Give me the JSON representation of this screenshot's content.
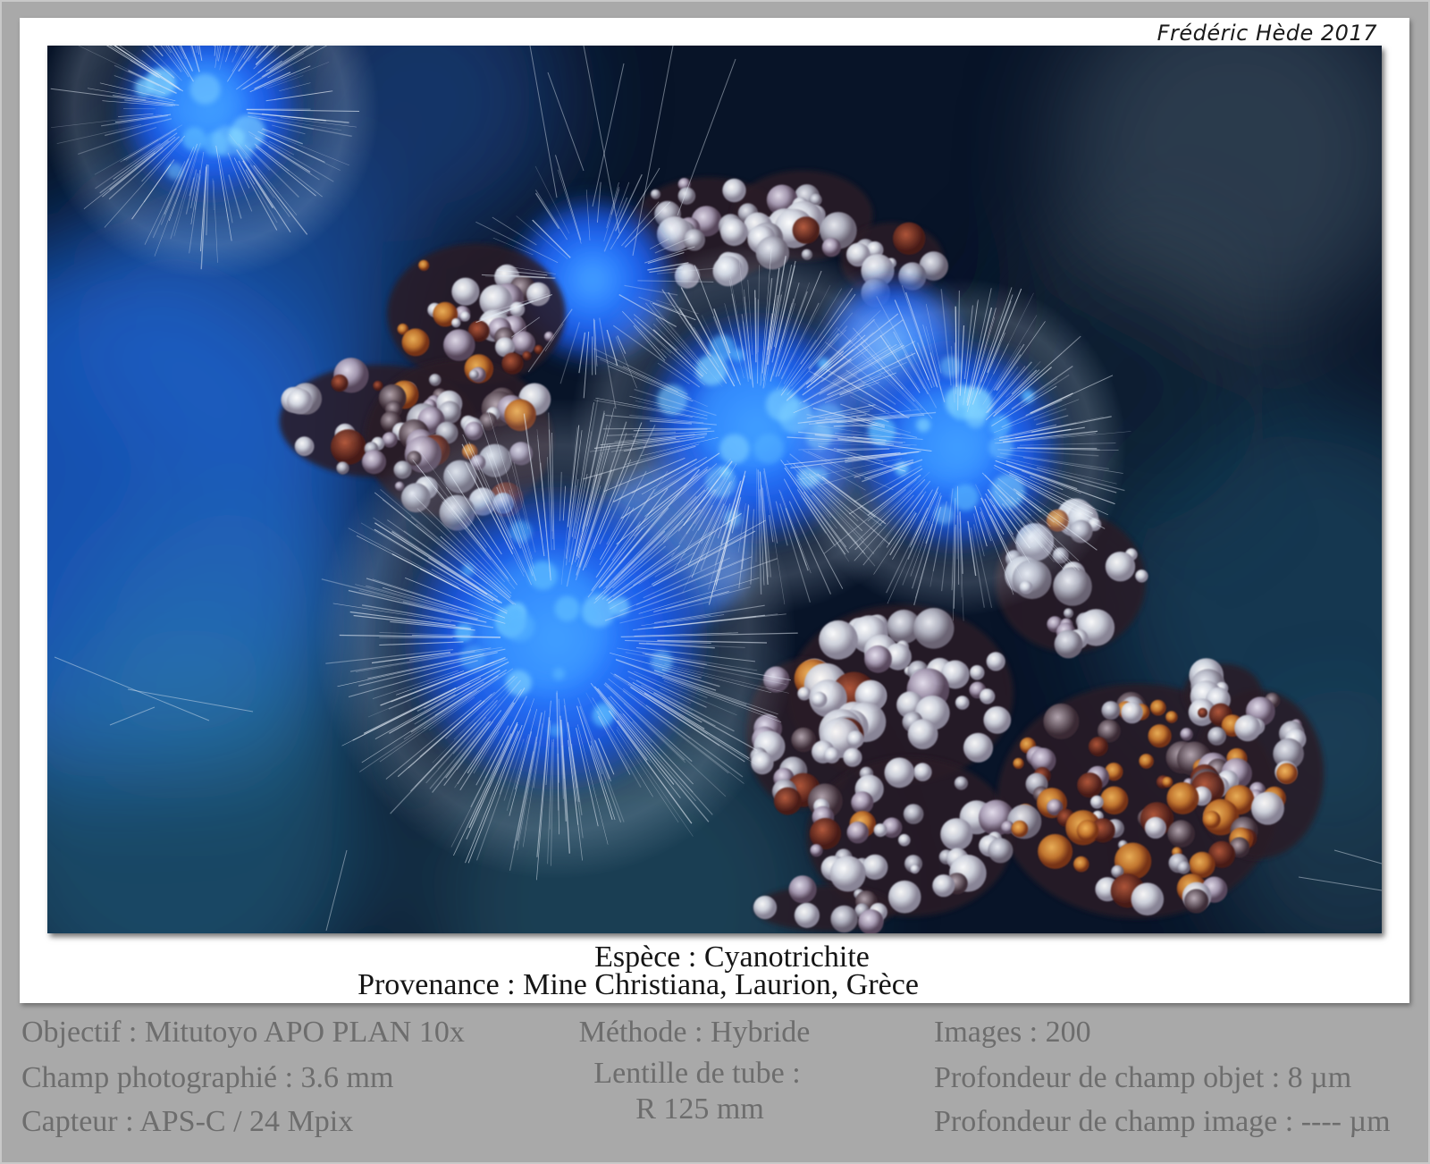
{
  "signature": "Frédéric Hède 2017",
  "caption": {
    "species": "Espèce : Cyanotrichite",
    "provenance": "Provenance : Mine Christiana, Laurion, Grèce"
  },
  "details": {
    "col1": [
      "Objectif : Mitutoyo APO PLAN 10x",
      "Champ photographié : 3.6 mm",
      "Capteur : APS-C / 24 Mpix"
    ],
    "col2": [
      "Méthode : Hybride",
      "Lentille de tube :",
      "R 125 mm"
    ],
    "col3": [
      "Images : 200",
      "Profondeur de champ objet : 8 µm",
      "Profondeur de champ image : ---- µm"
    ]
  },
  "colors": {
    "page_background": "#a9a9a9",
    "frame": "#ffffff",
    "caption_text": "#151515",
    "detail_text": "#6d6d6d",
    "crystal_blue": "#2a7cff"
  }
}
